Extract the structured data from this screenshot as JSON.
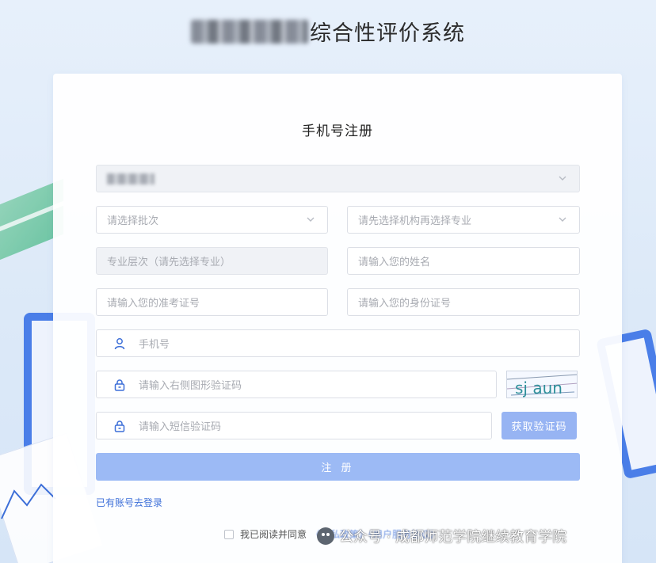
{
  "header": {
    "title_suffix": "综合性评价系统"
  },
  "form": {
    "title": "手机号注册",
    "batch_placeholder": "请选择批次",
    "institution_placeholder": "请先选择机构再选择专业",
    "level_placeholder": "专业层次（请先选择专业）",
    "name_placeholder": "请输入您的姓名",
    "exam_id_placeholder": "请输入您的准考证号",
    "id_card_placeholder": "请输入您的身份证号",
    "phone_placeholder": "手机号",
    "captcha_placeholder": "请输入右侧图形验证码",
    "captcha_text": "sj aun",
    "sms_placeholder": "请输入短信验证码",
    "sms_button": "获取验证码",
    "register_button": "注 册",
    "login_link": "已有账号去登录",
    "agree_text": "我已阅读并同意",
    "agree_links": "《隐私政策》《用户服务协议》"
  },
  "watermark": {
    "text": "公众号 · 成都师范学院继续教育学院"
  },
  "colors": {
    "primary": "#3d6fd8",
    "button_disabled": "#9cbaf5",
    "field_border": "#dcdfe6"
  },
  "icons": {
    "chevron": "chevron-down-icon",
    "user": "user-icon",
    "lock": "lock-icon"
  }
}
